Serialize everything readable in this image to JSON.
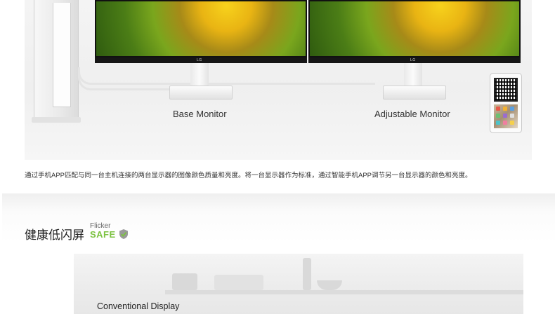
{
  "hero": {
    "monitor_brand": "LG",
    "labels": {
      "base_monitor": "Base Monitor",
      "adjustable_monitor": "Adjustable Monitor"
    }
  },
  "description": "通过手机APP匹配与同一台主机连接的两台显示器的图像颜色质量和亮度。将一台显示器作为标准，通过智能手机APP调节另一台显示器的颜色和亮度。",
  "section": {
    "title": "健康低闪屏",
    "badge_top": "Flicker",
    "badge_bottom": "SAFE"
  },
  "comparison": {
    "conventional_label": "Conventional Display"
  },
  "colors": {
    "flicker_safe_green": "#7cc241",
    "background": "#ffffff"
  }
}
